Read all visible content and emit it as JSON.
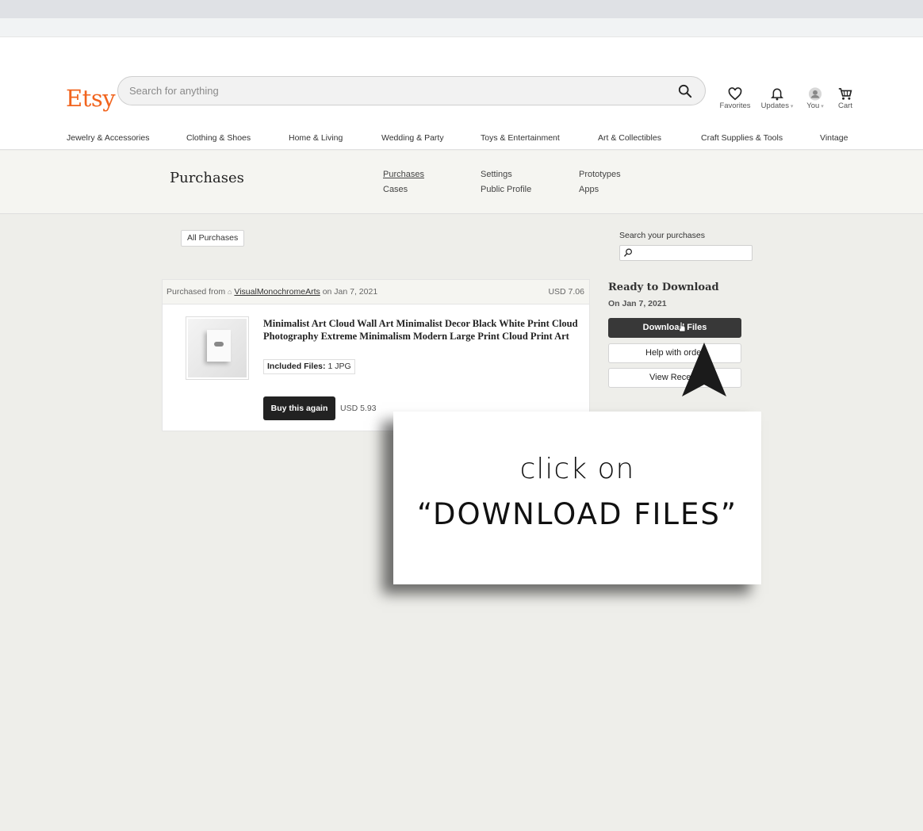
{
  "header": {
    "logo": "Etsy",
    "search_placeholder": "Search for anything",
    "favorites_label": "Favorites",
    "updates_label": "Updates",
    "you_label": "You",
    "cart_label": "Cart"
  },
  "categories": [
    "Jewelry & Accessories",
    "Clothing & Shoes",
    "Home & Living",
    "Wedding & Party",
    "Toys & Entertainment",
    "Art & Collectibles",
    "Craft Supplies & Tools",
    "Vintage"
  ],
  "subheader": {
    "title": "Purchases",
    "links": [
      "Purchases",
      "Cases",
      "Settings",
      "Public Profile",
      "Prototypes",
      "Apps"
    ]
  },
  "filters": {
    "all_purchases": "All Purchases",
    "search_label": "Search your purchases"
  },
  "order": {
    "purchased_from": "Purchased from",
    "shop_name": "VisualMonochromeArts",
    "date_text": "on Jan 7, 2021",
    "total": "USD 7.06",
    "item_title": "Minimalist Art Cloud Wall Art Minimalist Decor Black White Print Cloud Photography Extreme Minimalism Modern Large Print Cloud Print Art",
    "files_label": "Included Files:",
    "files_value": "1 JPG",
    "buy_again": "Buy this again",
    "item_price": "USD 5.93"
  },
  "download_panel": {
    "title": "Ready to Download",
    "date": "On Jan 7, 2021",
    "download_button": "Download Files",
    "help_button": "Help with order",
    "receipt_button": "View Receipt"
  },
  "overlay": {
    "line1": "click  on",
    "line2": "“DOWNLOAD  FILES”"
  },
  "colors": {
    "brand": "#f1641e",
    "dark_button": "#383838",
    "page_bg": "#eeeeea"
  }
}
